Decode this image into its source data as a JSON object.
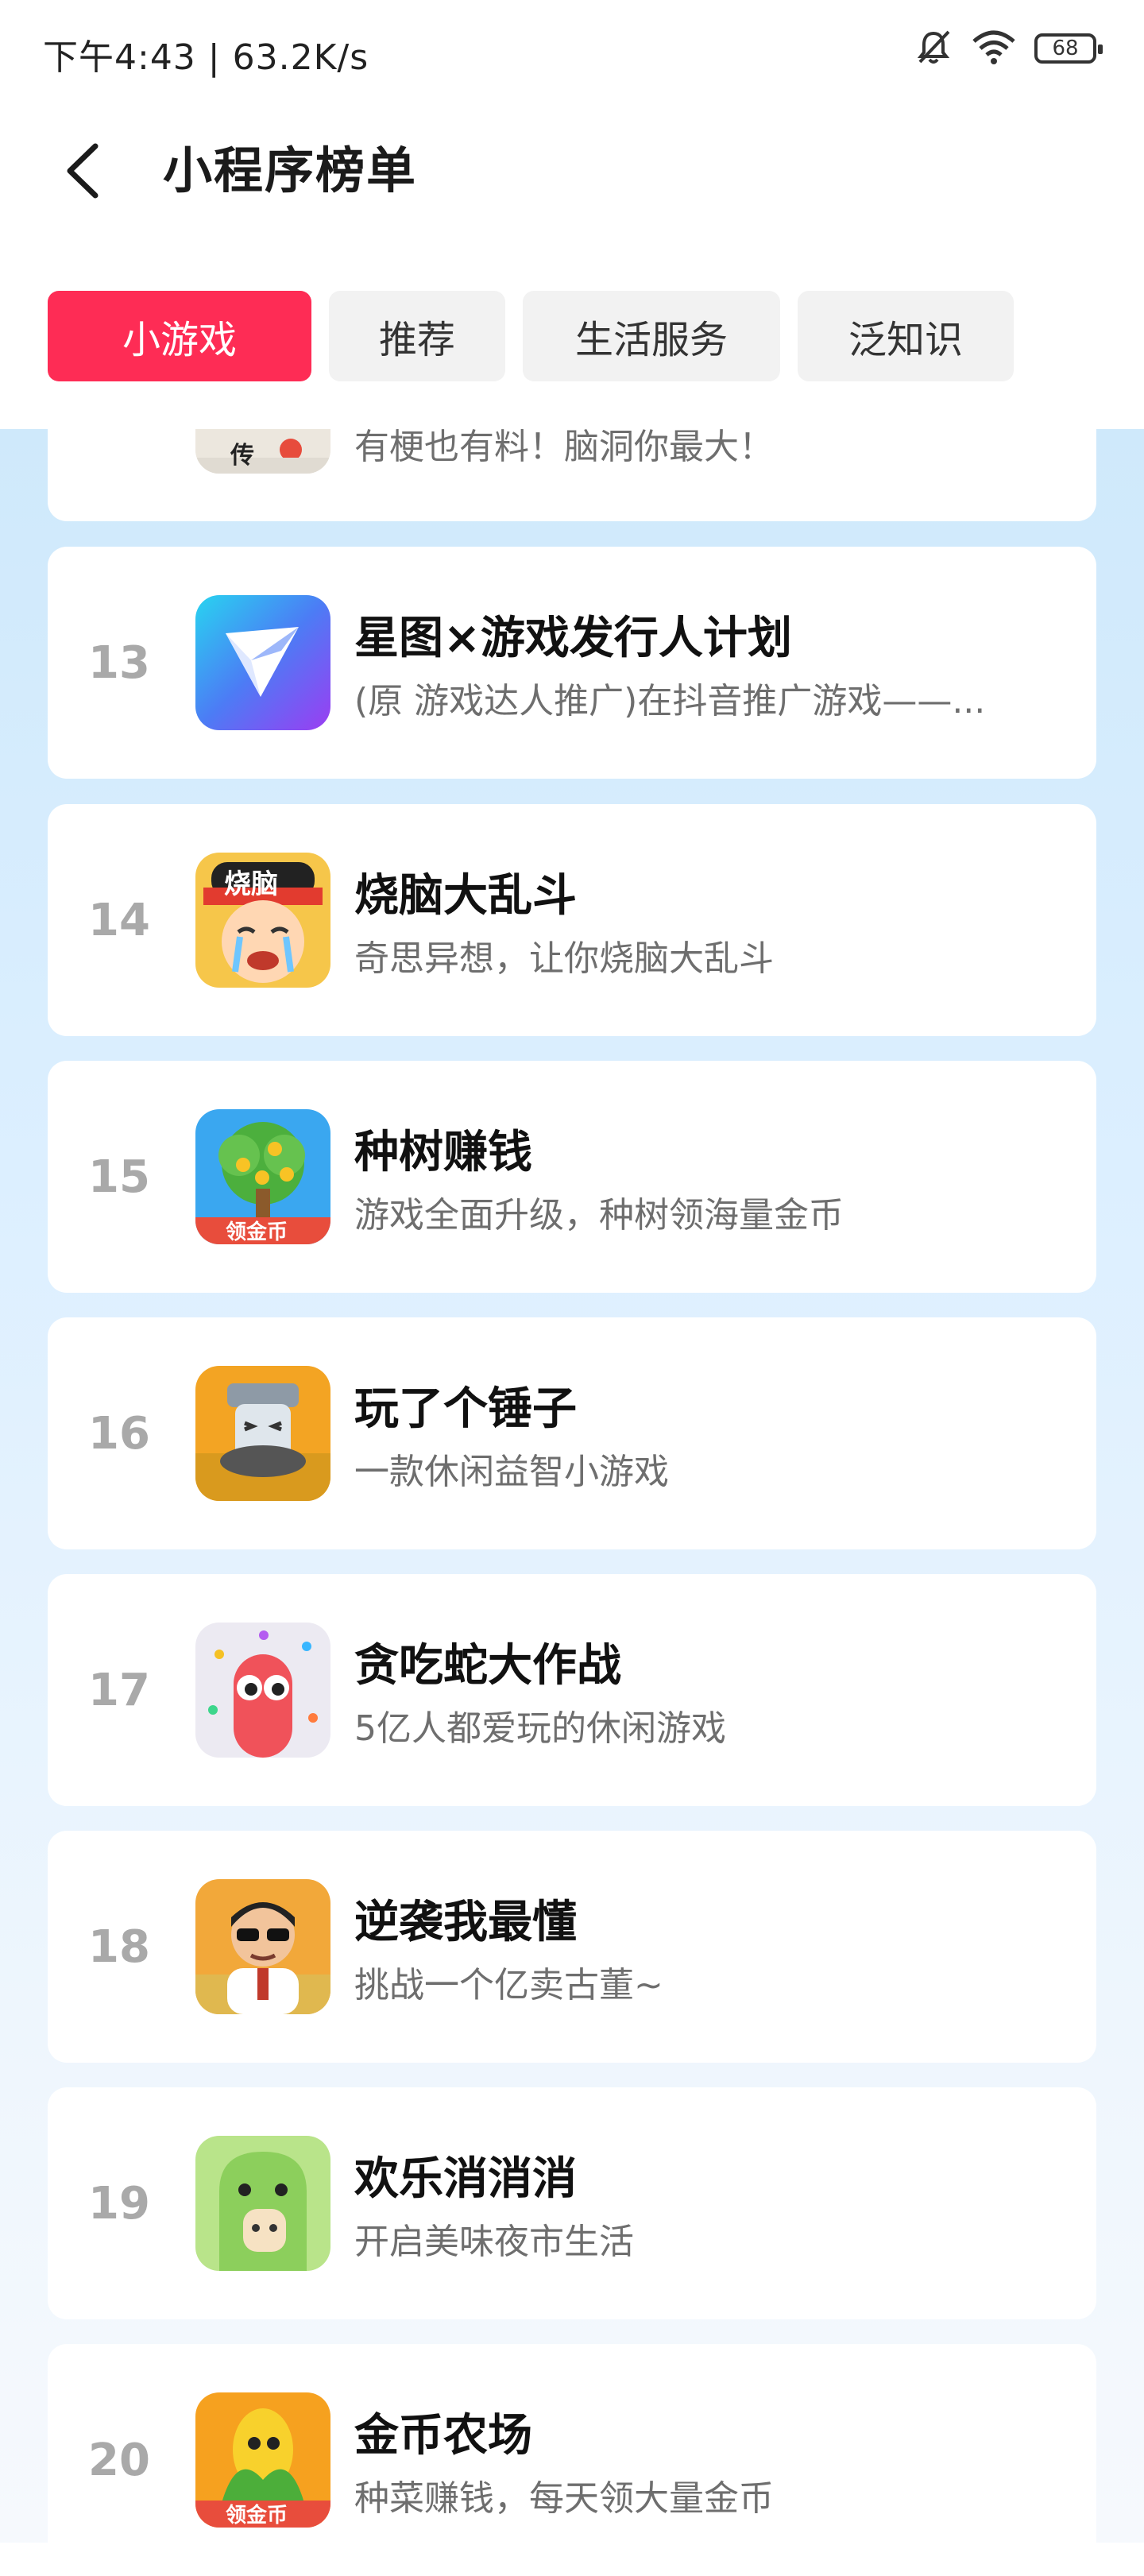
{
  "status_bar": {
    "time_speed": "下午4:43 | 63.2K/s",
    "battery": "68"
  },
  "header": {
    "title": "小程序榜单"
  },
  "tabs": [
    {
      "label": "小游戏",
      "active": true
    },
    {
      "label": "推荐",
      "active": false
    },
    {
      "label": "生活服务",
      "active": false
    },
    {
      "label": "泛知识",
      "active": false
    }
  ],
  "partial_item": {
    "desc": "有梗也有料！脑洞你最大！",
    "icon_text": "传"
  },
  "items": [
    {
      "rank": "13",
      "name": "星图×游戏发行人计划",
      "desc": "(原 游戏达人推广)在抖音推广游戏——...",
      "icon": "xingtu-icon"
    },
    {
      "rank": "14",
      "name": "烧脑大乱斗",
      "desc": "奇思异想，让你烧脑大乱斗",
      "icon": "crying-boy-icon",
      "icon_text": "烧脑"
    },
    {
      "rank": "15",
      "name": "种树赚钱",
      "desc": "游戏全面升级，种树领海量金币",
      "icon": "money-tree-icon",
      "icon_text": "领金币"
    },
    {
      "rank": "16",
      "name": "玩了个锤子",
      "desc": "一款休闲益智小游戏",
      "icon": "hammer-icon"
    },
    {
      "rank": "17",
      "name": "贪吃蛇大作战",
      "desc": "5亿人都爱玩的休闲游戏",
      "icon": "snake-icon"
    },
    {
      "rank": "18",
      "name": "逆袭我最懂",
      "desc": "挑战一个亿卖古董~",
      "icon": "man-sunglasses-icon"
    },
    {
      "rank": "19",
      "name": "欢乐消消消",
      "desc": "开启美味夜市生活",
      "icon": "dinosaur-icon"
    },
    {
      "rank": "20",
      "name": "金币农场",
      "desc": "种菜赚钱，每天领大量金币",
      "icon": "corn-icon",
      "icon_text": "领金币"
    }
  ]
}
